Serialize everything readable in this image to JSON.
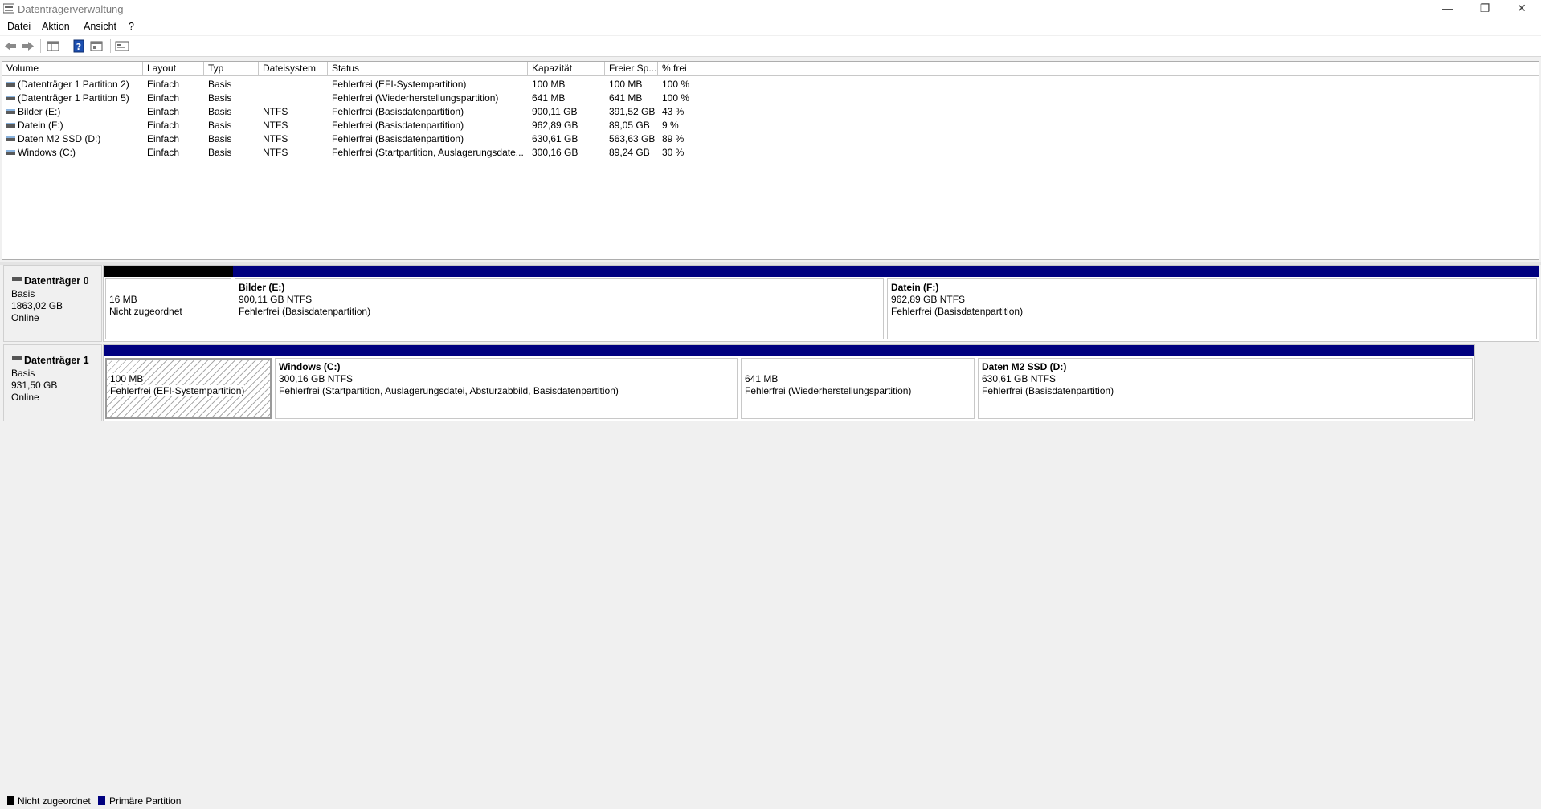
{
  "window": {
    "title": "Datenträgerverwaltung",
    "controls": {
      "minimize": "—",
      "maximize": "❐",
      "close": "✕"
    }
  },
  "menu": [
    "Datei",
    "Aktion",
    "Ansicht",
    "?"
  ],
  "toolbar": {
    "buttons": [
      "back-icon",
      "forward-icon",
      "list-view-icon",
      "help-icon",
      "properties-icon",
      "console-icon"
    ]
  },
  "volume_list": {
    "columns": [
      "Volume",
      "Layout",
      "Typ",
      "Dateisystem",
      "Status",
      "Kapazität",
      "Freier Sp...",
      "% frei"
    ],
    "rows": [
      [
        "(Datenträger 1 Partition 2)",
        "Einfach",
        "Basis",
        "",
        "Fehlerfrei (EFI-Systempartition)",
        "100 MB",
        "100 MB",
        "100 %"
      ],
      [
        "(Datenträger 1 Partition 5)",
        "Einfach",
        "Basis",
        "",
        "Fehlerfrei (Wiederherstellungspartition)",
        "641 MB",
        "641 MB",
        "100 %"
      ],
      [
        "Bilder (E:)",
        "Einfach",
        "Basis",
        "NTFS",
        "Fehlerfrei (Basisdatenpartition)",
        "900,11 GB",
        "391,52 GB",
        "43 %"
      ],
      [
        "Datein (F:)",
        "Einfach",
        "Basis",
        "NTFS",
        "Fehlerfrei (Basisdatenpartition)",
        "962,89 GB",
        "89,05 GB",
        "9 %"
      ],
      [
        "Daten M2 SSD (D:)",
        "Einfach",
        "Basis",
        "NTFS",
        "Fehlerfrei (Basisdatenpartition)",
        "630,61 GB",
        "563,63 GB",
        "89 %"
      ],
      [
        "Windows (C:)",
        "Einfach",
        "Basis",
        "NTFS",
        "Fehlerfrei (Startpartition, Auslagerungsdate...",
        "300,16 GB",
        "89,24 GB",
        "30 %"
      ]
    ]
  },
  "disks": [
    {
      "name": "Datenträger 0",
      "type": "Basis",
      "size": "1863,02 GB",
      "state": "Online",
      "partitions": [
        {
          "title": "",
          "line1": "16 MB",
          "line2": "Nicht zugeordnet",
          "kind": "unallocated"
        },
        {
          "title": "Bilder  (E:)",
          "line1": "900,11 GB NTFS",
          "line2": "Fehlerfrei (Basisdatenpartition)",
          "kind": "primary"
        },
        {
          "title": "Datein  (F:)",
          "line1": "962,89 GB NTFS",
          "line2": "Fehlerfrei (Basisdatenpartition)",
          "kind": "primary"
        }
      ]
    },
    {
      "name": "Datenträger 1",
      "type": "Basis",
      "size": "931,50 GB",
      "state": "Online",
      "partitions": [
        {
          "title": "",
          "line1": "100 MB",
          "line2": "Fehlerfrei (EFI-Systempartition)",
          "kind": "primary-selected"
        },
        {
          "title": "Windows  (C:)",
          "line1": "300,16 GB NTFS",
          "line2": "Fehlerfrei (Startpartition, Auslagerungsdatei, Absturzabbild, Basisdatenpartition)",
          "kind": "primary"
        },
        {
          "title": "",
          "line1": "641 MB",
          "line2": "Fehlerfrei (Wiederherstellungspartition)",
          "kind": "primary"
        },
        {
          "title": "Daten M2 SSD  (D:)",
          "line1": "630,61 GB NTFS",
          "line2": "Fehlerfrei (Basisdatenpartition)",
          "kind": "primary"
        }
      ]
    }
  ],
  "legend": [
    {
      "label": "Nicht zugeordnet",
      "color": "#000000"
    },
    {
      "label": "Primäre Partition",
      "color": "#00007f"
    }
  ],
  "colors": {
    "unallocated": "#000000",
    "primary": "#00007f"
  }
}
